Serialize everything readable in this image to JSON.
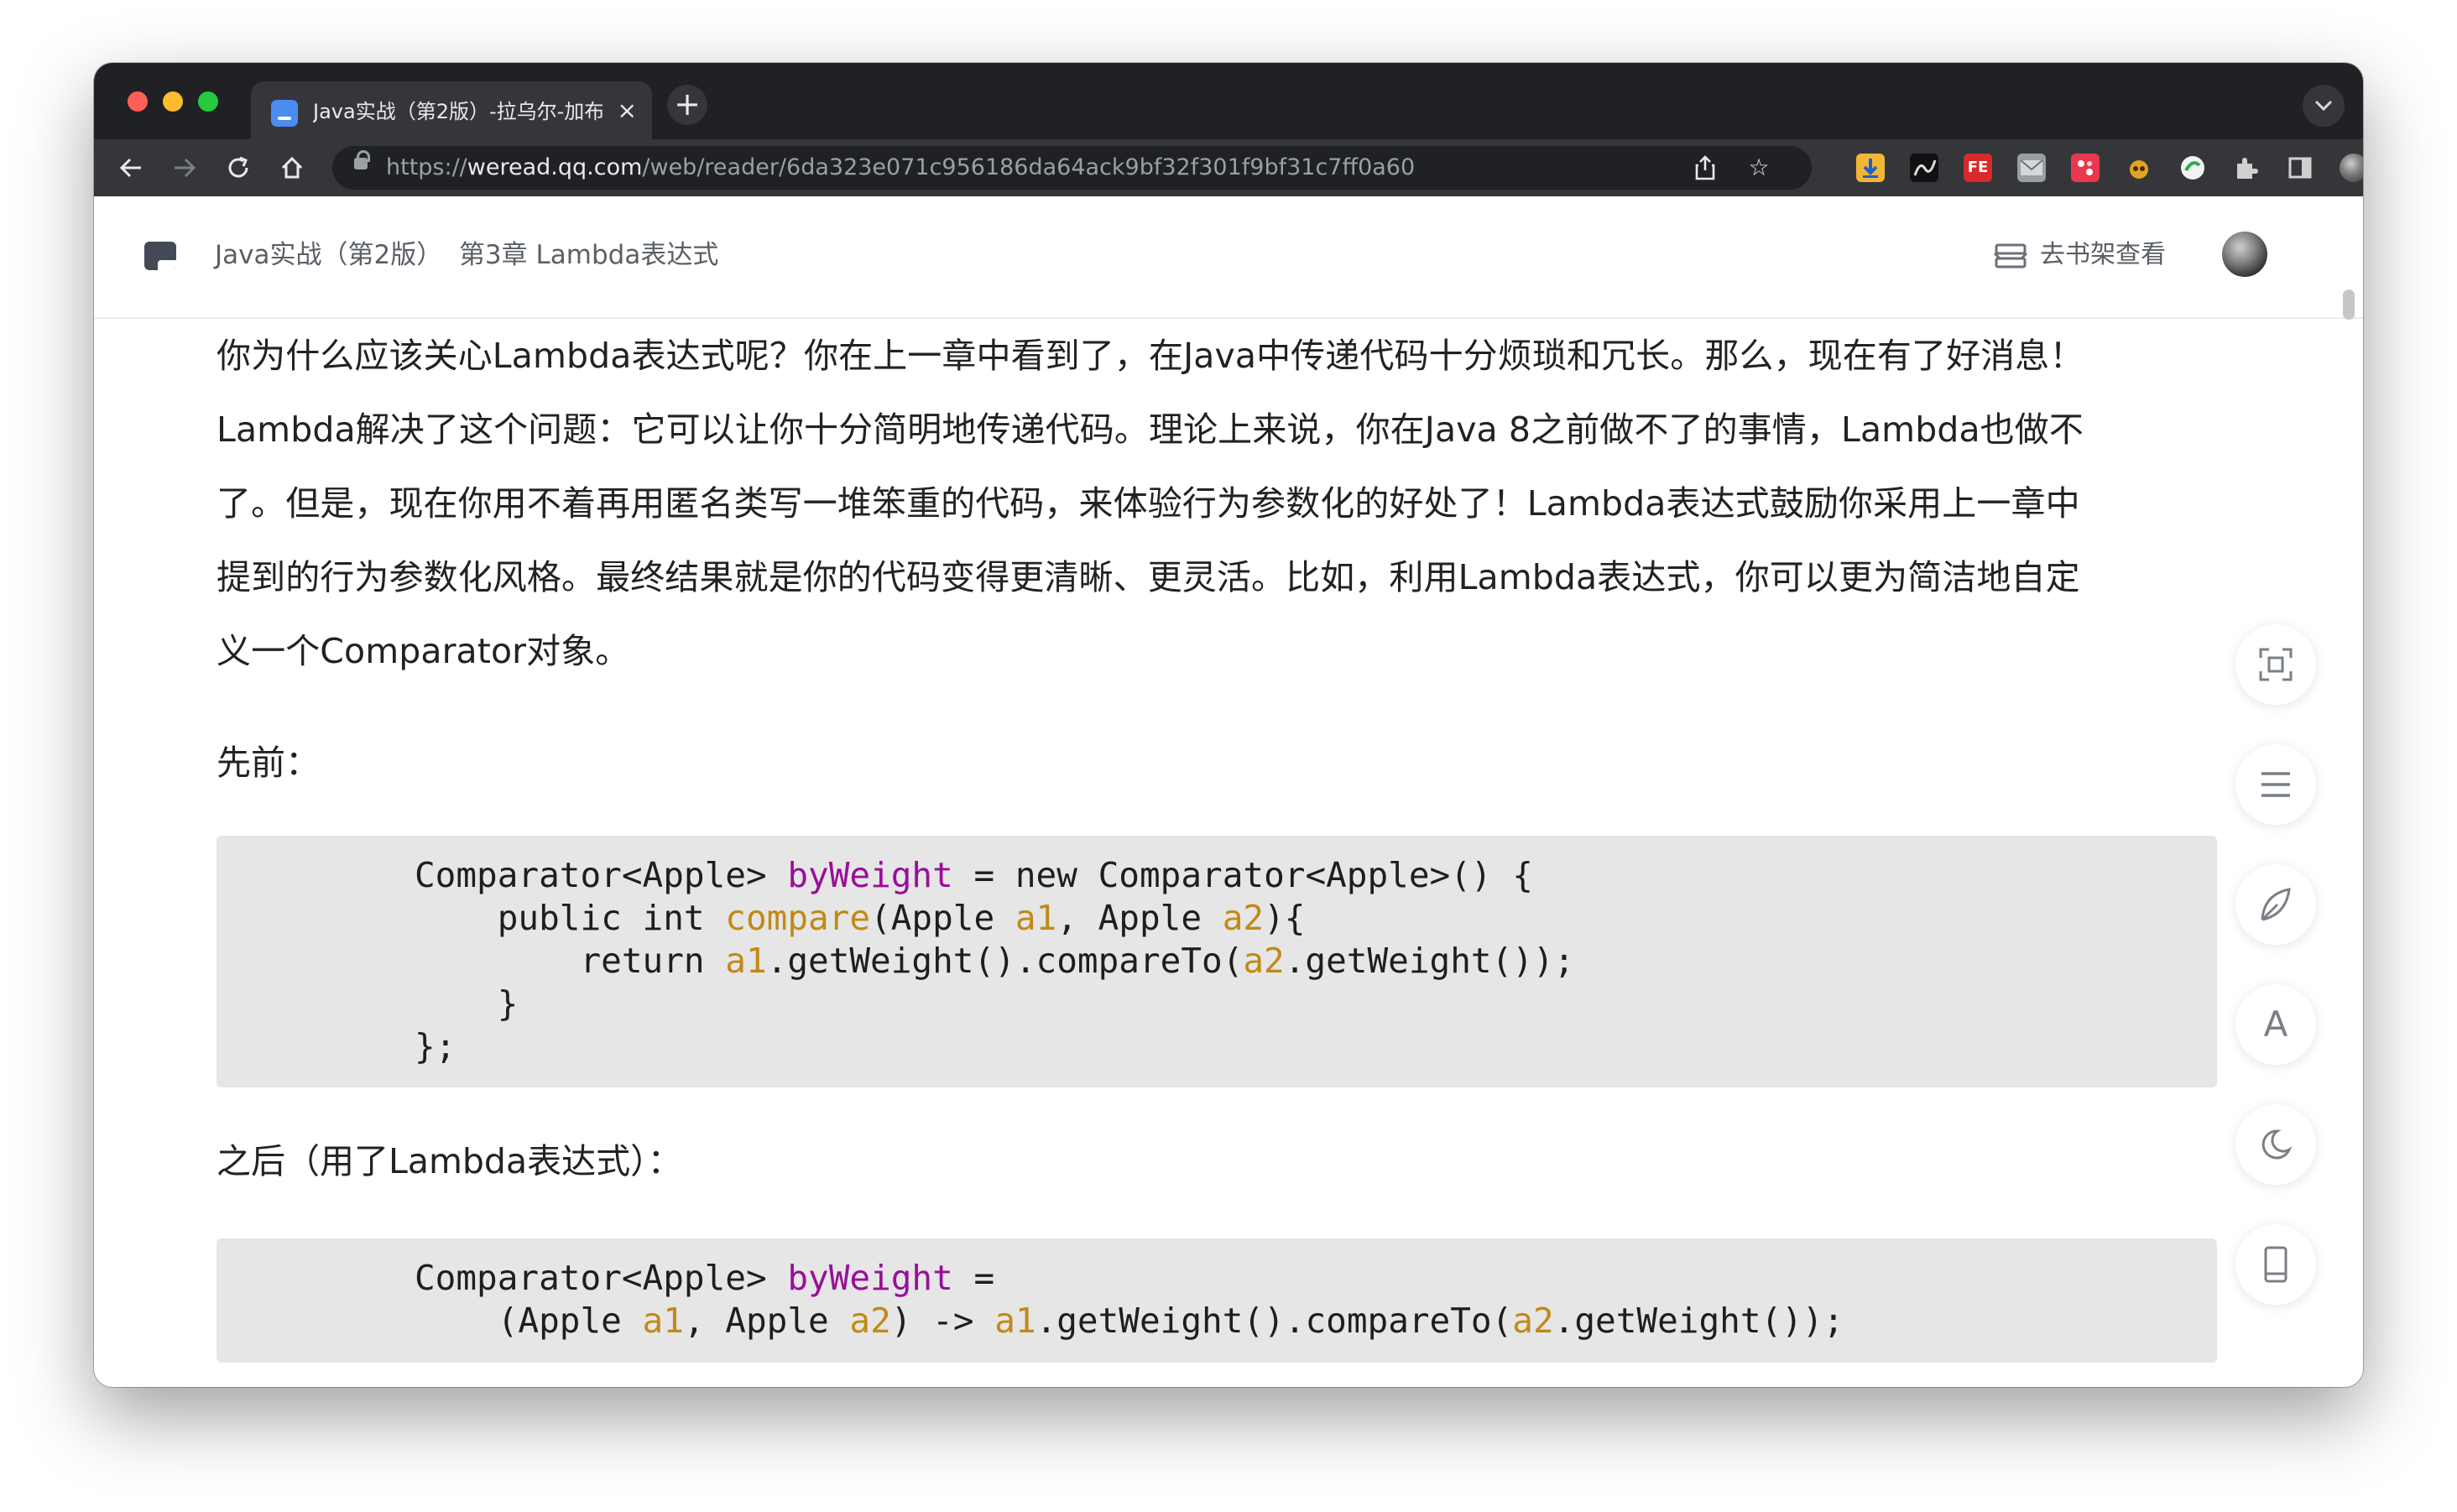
{
  "browser": {
    "traffic_lights": {
      "close_color": "#ff5f57",
      "minimize_color": "#febc2e",
      "maximize_color": "#28c840"
    },
    "tab": {
      "title": "Java实战（第2版）-拉乌尔-加布",
      "favicon": "weread-icon"
    },
    "new_tab_label": "+",
    "url": {
      "scheme": "https://",
      "domain": "weread.qq.com",
      "path": "/web/reader/6da323e071c956186da64ack9bf32f301f9bf31c7ff0a60"
    },
    "extensions": [
      "download-icon",
      "gesture-extension-icon",
      "fe-helper-icon",
      "mail-icon",
      "red-square-extension-icon",
      "monkey-icon",
      "green-circle-icon",
      "puzzle-icon",
      "sidebar-icon"
    ]
  },
  "reader": {
    "breadcrumb": {
      "book": "Java实战（第2版）",
      "chapter": "第3章 Lambda表达式"
    },
    "shelf_button": "去书架查看"
  },
  "article": {
    "paragraph_lines": [
      "你为什么应该关心Lambda表达式呢？你在上一章中看到了，在Java中传递代码十分烦琐和冗长。那么，现在有了好消息！",
      "Lambda解决了这个问题：它可以让你十分简明地传递代码。理论上来说，你在Java 8之前做不了的事情，Lambda也做不",
      "了。但是，现在你用不着再用匿名类写一堆笨重的代码，来体验行为参数化的好处了！Lambda表达式鼓励你采用上一章中",
      "提到的行为参数化风格。最终结果就是你的代码变得更清晰、更灵活。比如，利用Lambda表达式，你可以更为简洁地自定",
      "义一个Comparator对象。"
    ],
    "label_before": "先前：",
    "code_before": {
      "l1a": "Comparator<Apple> ",
      "l1b": "byWeight",
      "l1c": " = new Comparator<Apple>() {",
      "l2a": "    public int ",
      "l2b": "compare",
      "l2c": "(Apple ",
      "l2d": "a1",
      "l2e": ", Apple ",
      "l2f": "a2",
      "l2g": "){",
      "l3a": "        return ",
      "l3b": "a1",
      "l3c": ".getWeight().compareTo(",
      "l3d": "a2",
      "l3e": ".getWeight());",
      "l4": "    }",
      "l5": "};"
    },
    "label_after": "之后（用了Lambda表达式）：",
    "code_after": {
      "l1a": "Comparator<Apple> ",
      "l1b": "byWeight",
      "l1c": " =",
      "l2a": "    (Apple ",
      "l2b": "a1",
      "l2c": ", Apple ",
      "l2d": "a2",
      "l2e": ") -> ",
      "l2f": "a1",
      "l2g": ".getWeight().compareTo(",
      "l2h": "a2",
      "l2i": ".getWeight());"
    },
    "syntax_colors": {
      "identifier": "#990f99",
      "parameter": "#c18a16"
    }
  },
  "side_toolbar": [
    "fullscreen-icon",
    "table-of-contents-icon",
    "notes-icon",
    "font-icon",
    "dark-mode-icon",
    "phone-icon"
  ],
  "side_toolbar_font_label": "A"
}
